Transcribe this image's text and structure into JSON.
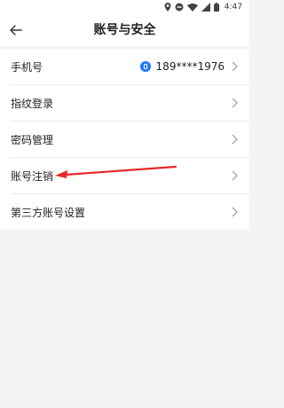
{
  "status_bar": {
    "time": "4:47",
    "icons": [
      "location-icon",
      "dnd-icon",
      "wifi-icon",
      "signal-icon",
      "battery-icon"
    ]
  },
  "header": {
    "title": "账号与安全",
    "back_icon": "arrow-left-icon"
  },
  "settings": {
    "items": [
      {
        "label": "手机号",
        "value": "189****1976"
      },
      {
        "label": "指纹登录"
      },
      {
        "label": "密码管理"
      },
      {
        "label": "账号注销"
      },
      {
        "label": "第三方账号设置"
      }
    ]
  },
  "colors": {
    "accent": "#1e78ff",
    "annotation": "#e8282a",
    "background": "#f4f4f4"
  }
}
